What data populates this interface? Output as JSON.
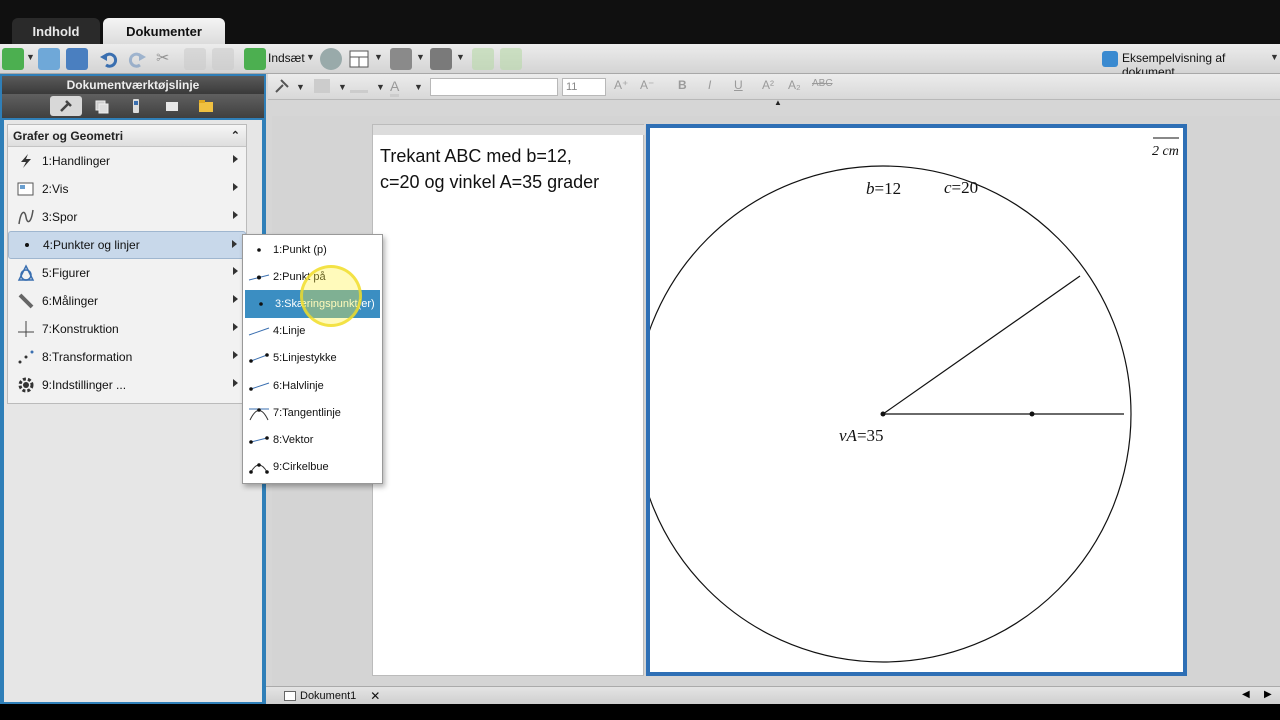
{
  "tabs": {
    "indhold": "Indhold",
    "dokumenter": "Dokumenter"
  },
  "toolbar": {
    "insert_label": "Indsæt",
    "preview_label": "Eksempelvisning af dokument"
  },
  "left_panel": {
    "title": "Dokumentværktøjslinje",
    "menu_title": "Grafer og Geometri",
    "items": [
      {
        "label": "1:Handlinger",
        "icon": "lightning-icon"
      },
      {
        "label": "2:Vis",
        "icon": "view-icon"
      },
      {
        "label": "3:Spor",
        "icon": "trace-icon"
      },
      {
        "label": "4:Punkter og linjer",
        "icon": "point-icon"
      },
      {
        "label": "5:Figurer",
        "icon": "shapes-icon"
      },
      {
        "label": "6:Målinger",
        "icon": "ruler-icon"
      },
      {
        "label": "7:Konstruktion",
        "icon": "construction-icon"
      },
      {
        "label": "8:Transformation",
        "icon": "transformation-icon"
      },
      {
        "label": "9:Indstillinger ...",
        "icon": "gear-icon"
      }
    ]
  },
  "submenu": {
    "items": [
      {
        "label": "1:Punkt (p)"
      },
      {
        "label": "2:Punkt på"
      },
      {
        "label": "3:Skæringspunkt(er)"
      },
      {
        "label": "4:Linje"
      },
      {
        "label": "5:Linjestykke"
      },
      {
        "label": "6:Halvlinje"
      },
      {
        "label": "7:Tangentlinje"
      },
      {
        "label": "8:Vektor"
      },
      {
        "label": "9:Cirkelbue"
      }
    ]
  },
  "format": {
    "font_size": "11"
  },
  "notes": {
    "line1": "Trekant ABC med b=12,",
    "line2": "c=20 og vinkel A=35 grader"
  },
  "geometry": {
    "scale_label": "2 cm",
    "b_var": "b",
    "b_val": "=12",
    "c_var": "c",
    "c_val": "=20",
    "angle_var": "vA",
    "angle_val": "=35"
  },
  "bottom": {
    "doc_tab": "Dokument1"
  },
  "colors": {
    "accent": "#2e6fb5",
    "highlight": "#3b8ec2"
  }
}
